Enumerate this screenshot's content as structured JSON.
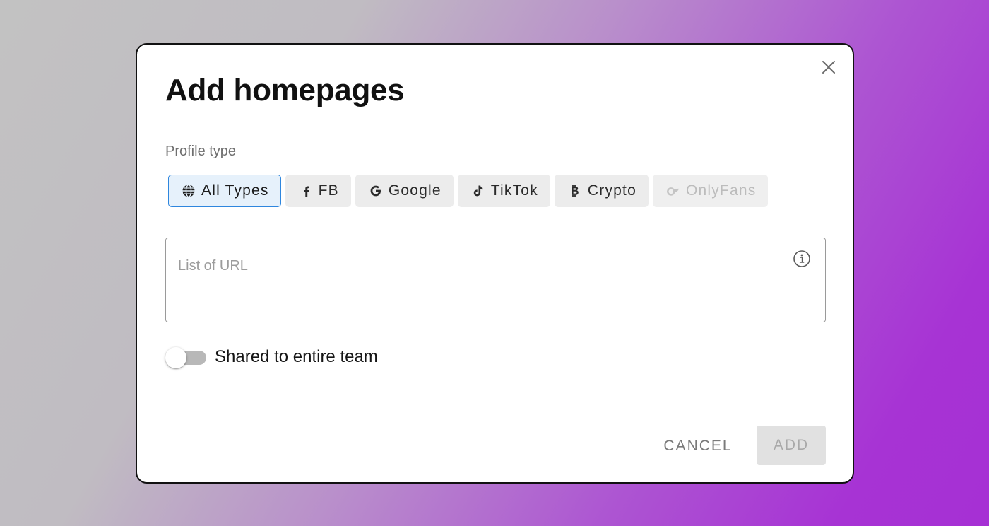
{
  "dialog": {
    "title": "Add homepages",
    "close_icon": "close-icon"
  },
  "profile_type": {
    "label": "Profile type",
    "selected": "All Types",
    "options": [
      {
        "label": "All Types",
        "icon": "globe-icon",
        "state": "selected"
      },
      {
        "label": "FB",
        "icon": "facebook-icon",
        "state": "normal"
      },
      {
        "label": "Google",
        "icon": "google-icon",
        "state": "normal"
      },
      {
        "label": "TikTok",
        "icon": "tiktok-icon",
        "state": "normal"
      },
      {
        "label": "Crypto",
        "icon": "bitcoin-icon",
        "state": "normal"
      },
      {
        "label": "OnlyFans",
        "icon": "onlyfans-icon",
        "state": "disabled"
      }
    ]
  },
  "url_list": {
    "placeholder": "List of URL",
    "value": "",
    "info_icon": "info-icon"
  },
  "shared_toggle": {
    "label": "Shared to entire team",
    "on": false
  },
  "actions": {
    "cancel_label": "CANCEL",
    "add_label": "ADD",
    "add_enabled": false
  },
  "colors": {
    "selected_border": "#2e86de",
    "selected_bg": "#e6f1fb",
    "chip_bg": "#ececec",
    "disabled_text": "#bcbcbc"
  }
}
